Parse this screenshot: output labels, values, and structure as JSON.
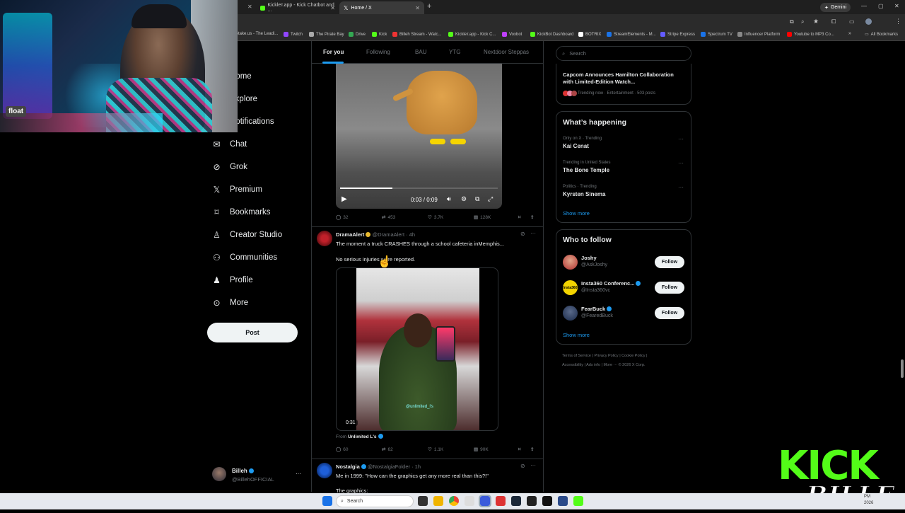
{
  "browser": {
    "tabs": [
      {
        "label": "Kickleт.app - Kick Chatbot and ...",
        "active": false
      },
      {
        "label": "Home / X",
        "active": true
      }
    ],
    "gemini_label": "Gemini",
    "bookmarks": [
      {
        "label": "Stake.us - The Leadi...",
        "color": "#2b6cff"
      },
      {
        "label": "Twitch",
        "color": "#9146ff"
      },
      {
        "label": "The Pirate Bay",
        "color": "#aaaaaa"
      },
      {
        "label": "Drive",
        "color": "#34a853"
      },
      {
        "label": "Kick",
        "color": "#53fc18"
      },
      {
        "label": "Billeh Stream - Watc...",
        "color": "#e33"
      },
      {
        "label": "Kickleт.app - Kick C...",
        "color": "#53fc18"
      },
      {
        "label": "Voxbot",
        "color": "#c040ff"
      },
      {
        "label": "KickBot Dashboard",
        "color": "#53fc18"
      },
      {
        "label": "BOTRIX",
        "color": "#ffffff"
      },
      {
        "label": "StreamElements - M...",
        "color": "#1a73e8"
      },
      {
        "label": "Stripe Express",
        "color": "#635bff"
      },
      {
        "label": "Spectrum TV",
        "color": "#1a73e8"
      },
      {
        "label": "Influencer Platform",
        "color": "#888888"
      },
      {
        "label": "Youtube to MP3 Co...",
        "color": "#ff0000"
      }
    ],
    "all_bookmarks": "All Bookmarks"
  },
  "webcam": {
    "sticker": "float"
  },
  "nav": {
    "items": [
      {
        "label": "Home",
        "icon": "home-icon"
      },
      {
        "label": "Explore",
        "icon": "search-icon"
      },
      {
        "label": "Notifications",
        "icon": "bell-icon"
      },
      {
        "label": "Chat",
        "icon": "mail-icon"
      },
      {
        "label": "Grok",
        "icon": "grok-icon"
      },
      {
        "label": "Premium",
        "icon": "x-icon"
      },
      {
        "label": "Bookmarks",
        "icon": "bookmark-icon"
      },
      {
        "label": "Creator Studio",
        "icon": "creator-studio-icon"
      },
      {
        "label": "Communities",
        "icon": "communities-icon"
      },
      {
        "label": "Profile",
        "icon": "profile-icon"
      },
      {
        "label": "More",
        "icon": "more-icon"
      }
    ],
    "visible_partial": [
      "ome",
      "plore",
      "otifications"
    ],
    "post_label": "Post",
    "account": {
      "name": "Billeh",
      "handle": "@BillehOFFICIAL"
    }
  },
  "feed": {
    "tabs": [
      "For you",
      "Following",
      "BAU",
      "YTG",
      "Nextdoor Steppas"
    ],
    "video1": {
      "time": "0:03 / 0:09",
      "stats": {
        "replies": "32",
        "reposts": "453",
        "likes": "3.7K",
        "views": "128K"
      }
    },
    "tweet1": {
      "name": "DramaAlert",
      "handle": "@DramaAlert",
      "time": "· 4h",
      "text1": "The moment a truck CRASHES through a school cafeteria inMemphis...",
      "text2": "No serious injuries were reported.",
      "video_duration": "0:31",
      "watermark": "@unlimited_l's",
      "from_label": "From",
      "from_source": "Unlimited L's",
      "stats": {
        "replies": "60",
        "reposts": "62",
        "likes": "1.1K",
        "views": "90K"
      }
    },
    "tweet2": {
      "name": "Nostalgia",
      "handle": "@NostalgiaFolder",
      "time": "· 1h",
      "text1": "Me in 1999: \"How can the graphics get any more real than this?!\"",
      "text2": "The graphics:"
    }
  },
  "sidebar": {
    "search_placeholder": "Search",
    "top_trend": {
      "title": "Capcom Announces Hamilton Collaboration with Limited-Edition Watch...",
      "meta": "Trending now · Entertainment · 503 posts"
    },
    "whats_happening": {
      "title": "What’s happening",
      "trends": [
        {
          "meta": "Only on X · Trending",
          "name": "Kai Cenat"
        },
        {
          "meta": "Trending in United States",
          "name": "The Bone Temple"
        },
        {
          "meta": "Politics · Trending",
          "name": "Kyrsten Sinema"
        }
      ],
      "show_more": "Show more"
    },
    "who_to_follow": {
      "title": "Who to follow",
      "accounts": [
        {
          "name": "Joshy",
          "handle": "@AskJoshy",
          "button": "Follow"
        },
        {
          "name": "Insta360 Conferenc...",
          "handle": "@Insta360vc",
          "button": "Follow"
        },
        {
          "name": "FearBuck",
          "handle": "@FearedBuck",
          "button": "Follow"
        }
      ],
      "show_more": "Show more"
    },
    "footer": {
      "line1": "Terms of Service  |  Privacy Policy  |  Cookie Policy  |",
      "line2": "Accessibility  |  Ads info  |  More ···  © 2026 X Corp."
    }
  },
  "taskbar": {
    "search_label": "Search",
    "clock": "PM",
    "date": "2026"
  },
  "overlay": {
    "kick_text": "KICK",
    "signature": "BILLEH"
  },
  "colors": {
    "accent": "#1d9bf0",
    "kick_green": "#53fc18",
    "bg": "#000000"
  }
}
